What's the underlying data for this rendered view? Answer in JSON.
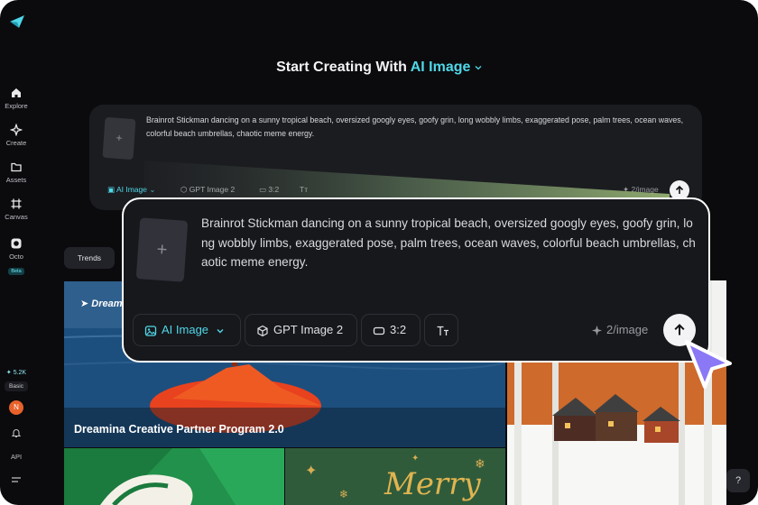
{
  "colors": {
    "background": "#0b0b0e",
    "accent": "#4fd7e8",
    "card": "#1b1c20",
    "cursor": "#8b78f5"
  },
  "sidebar": {
    "items": [
      {
        "label": "Explore",
        "icon": "home-icon"
      },
      {
        "label": "Create",
        "icon": "sparkle-icon"
      },
      {
        "label": "Assets",
        "icon": "folder-icon"
      },
      {
        "label": "Canvas",
        "icon": "canvas-icon"
      },
      {
        "label": "Octo",
        "icon": "octo-icon",
        "badge": "Beta"
      }
    ],
    "credits": "5.2K",
    "plan": "Basic",
    "avatar_initial": "N",
    "api_label": "API"
  },
  "header": {
    "title": "Start Creating With",
    "mode": "AI Image"
  },
  "prompt": {
    "text": "Brainrot Stickman dancing on a sunny tropical beach, oversized googly eyes, goofy grin, long wobbly limbs, exaggerated pose, palm trees, ocean waves, colorful beach umbrellas, chaotic meme energy.",
    "text_wrapped_big": "Brainrot Stickman dancing on a sunny tropical beach, oversized googly eyes, goofy grin, long wobbly limbs, exaggerated pose, palm trees, ocean waves, colorful beach umbrellas, chaotic meme energy.",
    "mode_label": "AI Image",
    "model_label": "GPT Image 2",
    "ratio_label": "3:2",
    "cost_label": "2/image"
  },
  "tabs": {
    "trends": "Trends"
  },
  "gallery": {
    "hero_brand": "Dreamina",
    "hero_title": "Dreamina Creative Partner Program 2.0",
    "merry_text": "Merry"
  },
  "help_label": "?"
}
